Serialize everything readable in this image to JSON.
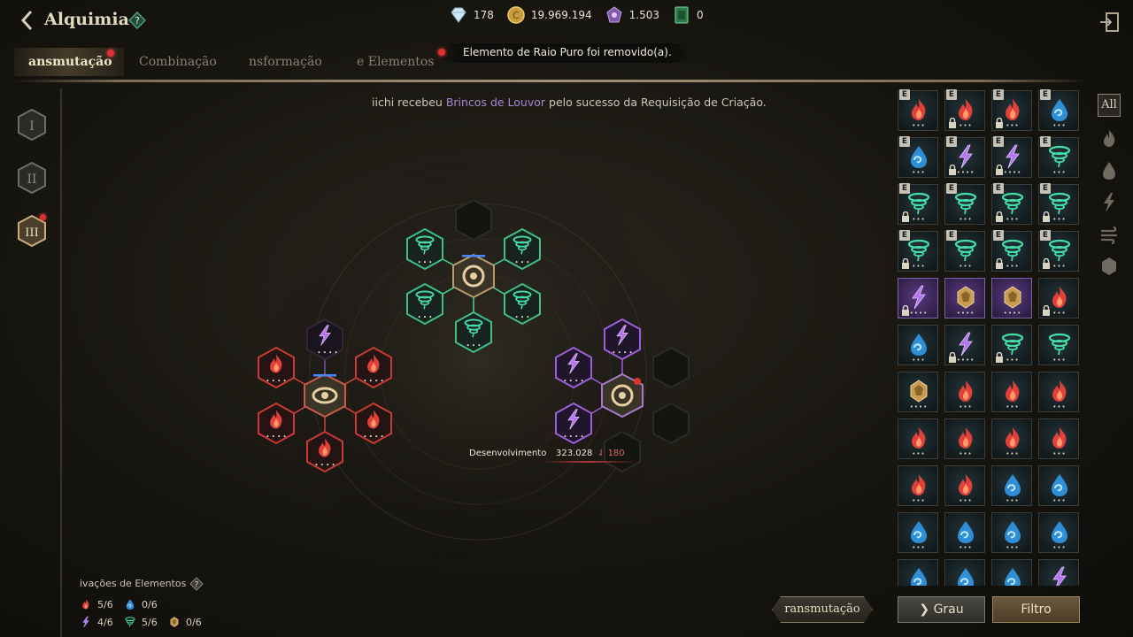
{
  "header": {
    "title": "Alquimia",
    "currencies": [
      {
        "icon": "diamond-icon",
        "value": "178"
      },
      {
        "icon": "gold-coin-icon",
        "value": "19.969.194"
      },
      {
        "icon": "gem-cluster-icon",
        "value": "1.503"
      },
      {
        "icon": "ticket-card-icon",
        "value": "0"
      }
    ]
  },
  "tabs": [
    {
      "label": "ansmutação",
      "active": true,
      "has_alert": true
    },
    {
      "label": "Combinação",
      "active": false
    },
    {
      "label": "nsformação",
      "active": false
    },
    {
      "label": "e Elementos",
      "active": false
    }
  ],
  "toast": "Elemento de Raio Puro foi removido(a).",
  "notice": {
    "prefix": "iichi recebeu ",
    "item": "Brincos de Louvor",
    "suffix": " pelo sucesso da Requisição de Criação."
  },
  "ranks": [
    {
      "label": "I",
      "active": false
    },
    {
      "label": "II",
      "active": false
    },
    {
      "label": "III",
      "active": true,
      "has_alert": true
    }
  ],
  "development": {
    "label": "Desenvolvimento",
    "value": "323.028",
    "cost": "180"
  },
  "inventory": {
    "rows": [
      [
        {
          "el": "fire",
          "e": true,
          "lock": false
        },
        {
          "el": "fire",
          "e": true,
          "lock": true
        },
        {
          "el": "fire",
          "e": true,
          "lock": true
        },
        {
          "el": "water",
          "e": true,
          "lock": false
        }
      ],
      [
        {
          "el": "water",
          "e": true,
          "lock": false
        },
        {
          "el": "lightning",
          "e": true,
          "lock": true
        },
        {
          "el": "lightning",
          "e": true,
          "lock": true
        },
        {
          "el": "wind",
          "e": true,
          "lock": false
        }
      ],
      [
        {
          "el": "wind",
          "e": true,
          "lock": true
        },
        {
          "el": "wind",
          "e": true,
          "lock": false
        },
        {
          "el": "wind",
          "e": true,
          "lock": true
        },
        {
          "el": "wind",
          "e": true,
          "lock": true
        }
      ],
      [
        {
          "el": "wind",
          "e": true,
          "lock": true
        },
        {
          "el": "wind",
          "e": true,
          "lock": false
        },
        {
          "el": "wind",
          "e": true,
          "lock": true
        },
        {
          "el": "wind",
          "e": true,
          "lock": true
        }
      ],
      [
        {
          "el": "lightning",
          "purple": true,
          "lock": true
        },
        {
          "el": "earth",
          "purple": true,
          "lock": false
        },
        {
          "el": "earth",
          "purple": true,
          "lock": false
        },
        {
          "el": "fire",
          "lock": true
        }
      ],
      [
        {
          "el": "water",
          "lock": false
        },
        {
          "el": "lightning",
          "lock": true
        },
        {
          "el": "wind",
          "lock": true
        },
        {
          "el": "wind",
          "lock": false
        }
      ],
      [
        {
          "el": "earth",
          "lock": false
        },
        {
          "el": "fire",
          "lock": false
        },
        {
          "el": "fire",
          "lock": false
        },
        {
          "el": "fire",
          "lock": false
        }
      ],
      [
        {
          "el": "fire",
          "lock": false
        },
        {
          "el": "fire",
          "lock": false
        },
        {
          "el": "fire",
          "lock": false
        },
        {
          "el": "fire",
          "lock": false
        }
      ],
      [
        {
          "el": "fire",
          "lock": false
        },
        {
          "el": "fire",
          "lock": false
        },
        {
          "el": "water",
          "lock": false
        },
        {
          "el": "water",
          "lock": false
        }
      ],
      [
        {
          "el": "water",
          "lock": false
        },
        {
          "el": "water",
          "lock": false
        },
        {
          "el": "water",
          "lock": false
        },
        {
          "el": "water",
          "lock": false
        }
      ],
      [
        {
          "el": "water",
          "lock": false
        },
        {
          "el": "water",
          "lock": false
        },
        {
          "el": "water",
          "lock": false
        },
        {
          "el": "lightning",
          "lock": false
        }
      ]
    ]
  },
  "filters": {
    "all_label": "All",
    "icons": [
      "fire-filter-icon",
      "water-filter-icon",
      "lightning-filter-icon",
      "wind-filter-icon",
      "earth-filter-icon"
    ]
  },
  "buttons": {
    "transmute": "ransmutação",
    "grade": "Grau",
    "filter": "Filtro"
  },
  "activations": {
    "title": "ivações de Elementos",
    "items": [
      {
        "icon": "fire-icon",
        "value": "5/6"
      },
      {
        "icon": "water-icon",
        "value": "0/6"
      },
      {
        "icon": "lightning-icon",
        "value": "4/6"
      },
      {
        "icon": "wind-icon",
        "value": "5/6"
      },
      {
        "icon": "earth-icon",
        "value": "0/6"
      }
    ]
  },
  "colors": {
    "fire": "#e2413b",
    "water": "#3aa8e6",
    "lightning": "#a45ee6",
    "wind": "#3fd6a0",
    "earth": "#c99a52",
    "alert": "#e03030"
  }
}
